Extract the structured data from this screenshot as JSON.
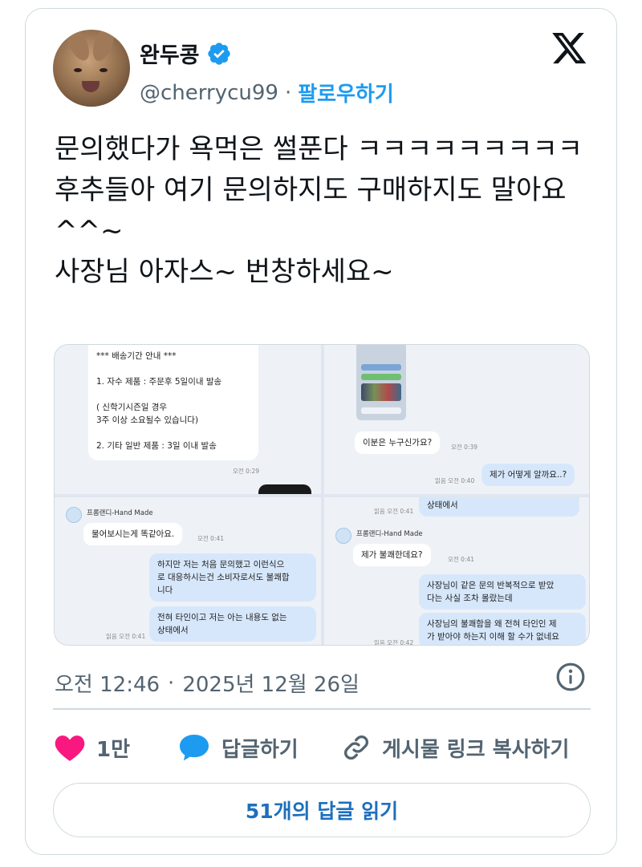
{
  "author": {
    "display_name": "완두콩",
    "handle": "@cherrycu99",
    "separator": "·",
    "follow_label": "팔로우하기"
  },
  "tweet": {
    "text": "문의했다가 욕먹은 썰푼다 ㅋㅋㅋㅋㅋㅋㅋㅋㅋ\n후추들아 여기 문의하지도 구매하지도 말아요 ^^~\n사장님 아자스~ 번창하세요~"
  },
  "media": {
    "panel1": {
      "message": "*** 배송기간 안내 ***\n\n1. 자수 제품 : 주문후 5일이내 발송\n\n( 신학기시즌일 경우\n3주 이상 소요될수 있습니다)\n\n2. 기타 일반 제품 : 3일 이내 발송",
      "time": "오전 0:29"
    },
    "panel2": {
      "question": "이분은 누구신가요?",
      "question_time": "오전 0:39",
      "reply": "제가 어떻게 알까요..?",
      "reply_meta": "읽음 오전 0:40"
    },
    "panel3": {
      "sender": "프롬랜디-Hand Made",
      "shop_msg": "물어보시는게 똑같아요.",
      "shop_time": "오전 0:41",
      "reply1": "하지만 저는 처음 문의했고 이런식으\n로 대응하시는건 소비자로서도 불쾌합\n니다",
      "reply2": "전혀 타인이고 저는 아는 내용도 없는\n상태에서",
      "reply_meta": "읽음 오전 0:41"
    },
    "panel4": {
      "top_fragment": "상태에서",
      "top_meta": "읽음 오전 0:41",
      "sender": "프롬랜디-Hand Made",
      "shop_msg": "제가 불쾌한데요?",
      "shop_time": "오전 0:41",
      "reply1": "사장님이 같은 문의 반복적으로 받았\n다는 사실 조차 몰랐는데",
      "reply2": "사장님의 불쾌함을 왜 전혀 타인인 제\n가 받아야 하는지 이해 할 수가 없네요",
      "reply_meta": "읽음 오전 0:42"
    }
  },
  "meta": {
    "time": "오전 12:46",
    "separator": "·",
    "date": "2025년 12월 26일"
  },
  "actions": {
    "like_count": "1만",
    "reply_label": "답글하기",
    "copy_label": "게시물 링크 복사하기"
  },
  "read_replies_label": "51개의 답글 읽기",
  "colors": {
    "verified": "#1d9bf0",
    "like_heart": "#f91880",
    "reply_bubble": "#1d9bf0",
    "link_blue": "#1d6fbd"
  }
}
